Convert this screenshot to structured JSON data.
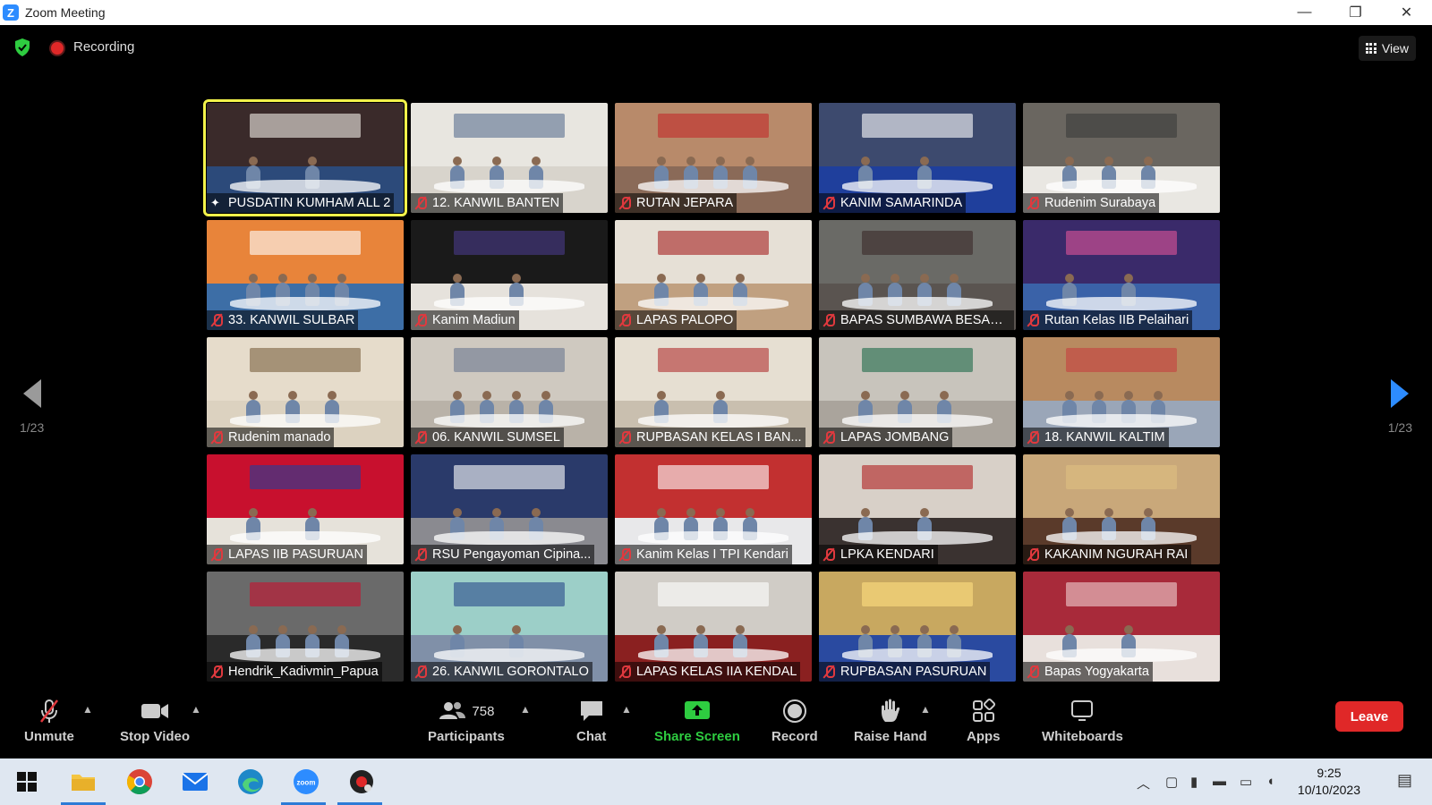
{
  "window": {
    "logo_letter": "Z",
    "title": "Zoom Meeting",
    "minimize": "—",
    "restore": "❐",
    "close": "✕"
  },
  "topbar": {
    "recording_label": "Recording",
    "view_label": "View"
  },
  "pagination": {
    "left": "1/23",
    "right": "1/23"
  },
  "participants": [
    {
      "name": "PUSDATIN KUMHAM ALL 2",
      "active": true,
      "pinned": true,
      "top": "#3a2a2a",
      "bot": "#2c4a7a",
      "accent": "#f1efe8"
    },
    {
      "name": "12. KANWIL BANTEN",
      "top": "#e8e6e0",
      "bot": "#d8d4cc",
      "accent": "#5a6f90"
    },
    {
      "name": "RUTAN JEPARA",
      "top": "#b88a6a",
      "bot": "#8a6a58",
      "accent": "#c22a2a"
    },
    {
      "name": "KANIM SAMARINDA",
      "top": "#3d4a6e",
      "bot": "#1f3f9c",
      "accent": "#ffffff"
    },
    {
      "name": "Rudenim Surabaya",
      "top": "#6a6660",
      "bot": "#e9e7e2",
      "accent": "#3a3a3a"
    },
    {
      "name": "33. KANWIL SULBAR",
      "top": "#e8843a",
      "bot": "#3d6ea6",
      "accent": "#ffffff"
    },
    {
      "name": "Kanim Madiun",
      "top": "#1a1a1a",
      "bot": "#e6e2dc",
      "accent": "#4a3a8a"
    },
    {
      "name": "LAPAS PALOPO",
      "top": "#e6e0d6",
      "bot": "#c0a080",
      "accent": "#a52020"
    },
    {
      "name": "BAPAS SUMBAWA BESAR ...",
      "top": "#6a6a66",
      "bot": "#5a5450",
      "accent": "#3a2a28"
    },
    {
      "name": "Rutan Kelas IIB Pelaihari",
      "top": "#3a2a6a",
      "bot": "#3a62a8",
      "accent": "#e0559a"
    },
    {
      "name": "Rudenim manado",
      "top": "#e6dccb",
      "bot": "#dcd2c0",
      "accent": "#7a6040"
    },
    {
      "name": "06. KANWIL SUMSEL",
      "top": "#cfc9c0",
      "bot": "#b9b2a8",
      "accent": "#6a7890"
    },
    {
      "name": "RUPBASAN KELAS I BAN...",
      "top": "#e6dfd2",
      "bot": "#c9bfaf",
      "accent": "#b03030"
    },
    {
      "name": "LAPAS JOMBANG",
      "top": "#c8c4bc",
      "bot": "#aaa49c",
      "accent": "#1e6a4a"
    },
    {
      "name": "18. KANWIL KALTIM",
      "top": "#b88a60",
      "bot": "#9aa6b8",
      "accent": "#c44040"
    },
    {
      "name": "LAPAS IIB PASURUAN",
      "top": "#c8102e",
      "bot": "#e6e2da",
      "accent": "#1f3f9c"
    },
    {
      "name": "RSU Pengayoman Cipina...",
      "top": "#2a3a6a",
      "bot": "#8a8a90",
      "accent": "#ffffff"
    },
    {
      "name": "Kanim Kelas I TPI Kendari",
      "top": "#c23030",
      "bot": "#e8e8ea",
      "accent": "#ffffff"
    },
    {
      "name": "LPKA KENDARI",
      "top": "#d8d0c8",
      "bot": "#3a3230",
      "accent": "#b02020"
    },
    {
      "name": "KAKANIM NGURAH RAI",
      "top": "#c9a87a",
      "bot": "#5a3a2a",
      "accent": "#e0c080"
    },
    {
      "name": "Hendrik_Kadivmin_Papua",
      "top": "#6a6a6a",
      "bot": "#2a2a2a",
      "accent": "#c8102e"
    },
    {
      "name": "26. KANWIL GORONTALO",
      "top": "#9ccfc8",
      "bot": "#8090a8",
      "accent": "#2a4a8a"
    },
    {
      "name": "LAPAS KELAS IIA KENDAL",
      "top": "#d0ccc6",
      "bot": "#8a2020",
      "accent": "#ffffff"
    },
    {
      "name": "RUPBASAN PASURUAN",
      "top": "#c8a860",
      "bot": "#2a4aa0",
      "accent": "#ffe080"
    },
    {
      "name": "Bapas Yogyakarta",
      "top": "#a82a3a",
      "bot": "#e8e0dc",
      "accent": "#f0d0d0"
    }
  ],
  "toolbar": {
    "unmute": "Unmute",
    "stop_video": "Stop Video",
    "participants": "Participants",
    "participants_count": "758",
    "chat": "Chat",
    "share_screen": "Share Screen",
    "record": "Record",
    "raise_hand": "Raise Hand",
    "apps": "Apps",
    "whiteboards": "Whiteboards",
    "leave": "Leave"
  },
  "taskbar": {
    "time": "9:25",
    "date": "10/10/2023"
  },
  "colors": {
    "share_green": "#2ecc40",
    "leave_red": "#e02828",
    "active_speaker": "#f2f24a",
    "zoom_blue": "#2d8cff"
  }
}
